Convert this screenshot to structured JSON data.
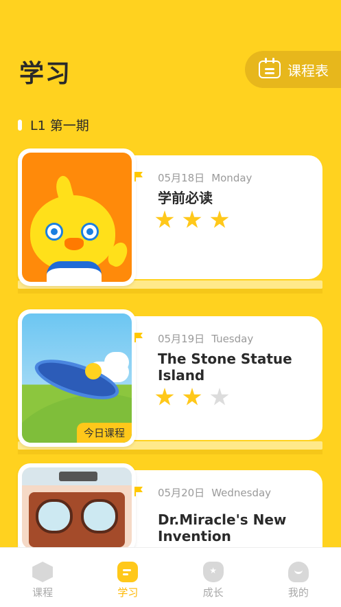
{
  "header": {
    "title": "学习",
    "schedule_label": "课程表"
  },
  "level": {
    "label": "L1 第一期"
  },
  "lessons": [
    {
      "date": "05月18日",
      "weekday": "Monday",
      "title": "学前必读",
      "stars_earned": 3,
      "stars_total": 3,
      "badge": ""
    },
    {
      "date": "05月19日",
      "weekday": "Tuesday",
      "title": "The Stone Statue Island",
      "stars_earned": 2,
      "stars_total": 3,
      "badge": "今日课程"
    },
    {
      "date": "05月20日",
      "weekday": "Wednesday",
      "title": "Dr.Miracle's New Invention",
      "stars_earned": null,
      "stars_total": null,
      "badge": ""
    }
  ],
  "tabbar": {
    "items": [
      {
        "label": "课程",
        "icon": "course-icon",
        "active": false
      },
      {
        "label": "学习",
        "icon": "study-icon",
        "active": true
      },
      {
        "label": "成长",
        "icon": "growth-icon",
        "active": false
      },
      {
        "label": "我的",
        "icon": "profile-icon",
        "active": false
      }
    ]
  },
  "colors": {
    "background": "#FFD21F",
    "accent": "#FFC81A",
    "star_off": "#DCDCDC"
  }
}
